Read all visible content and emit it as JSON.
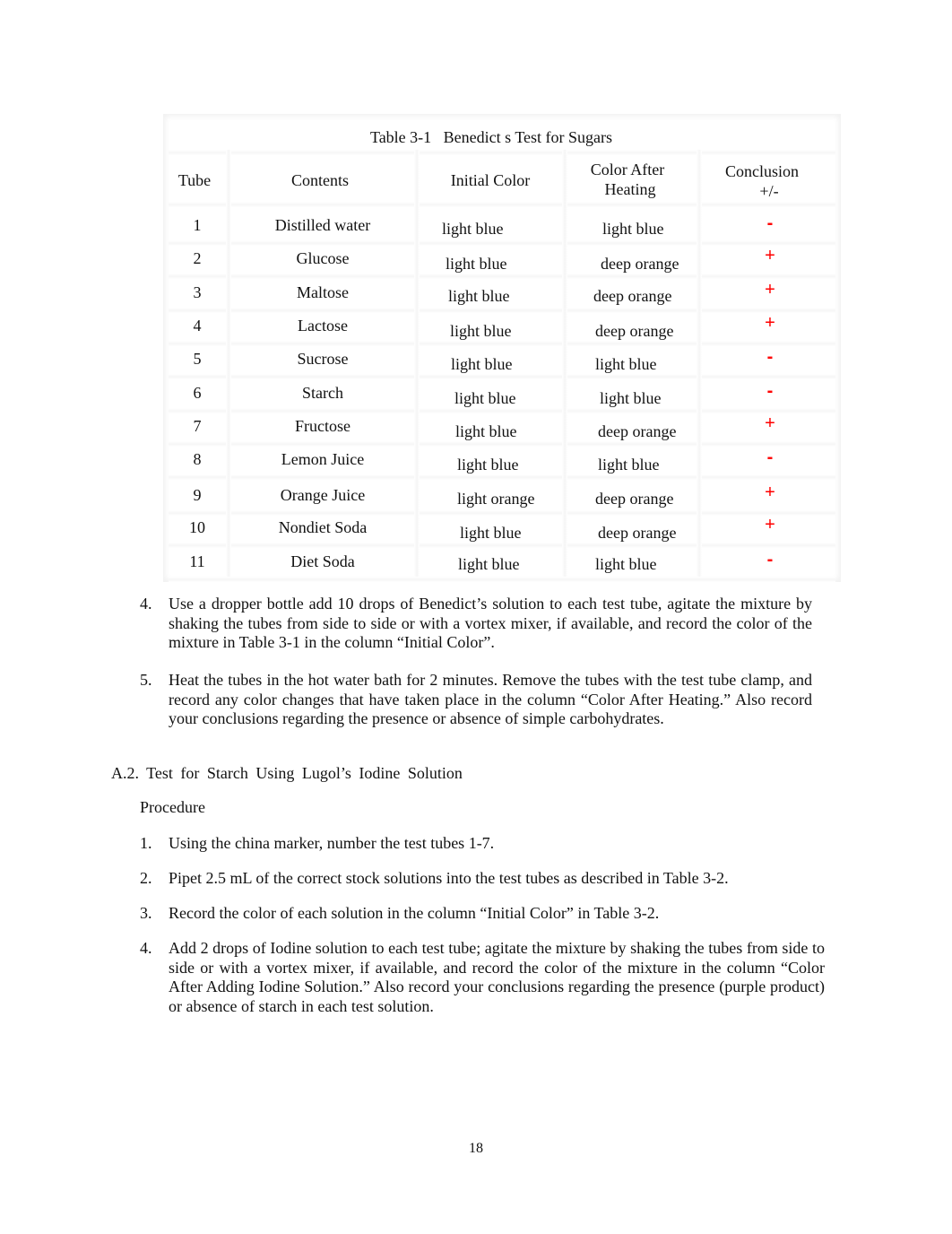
{
  "table": {
    "caption": "Table 3-1   Benedict s Test for Sugars",
    "headers": {
      "tube": "Tube",
      "contents": "Contents",
      "initial_color": "Initial Color",
      "color_after_line1": "Color After",
      "color_after_line2": "Heating",
      "conclusion_line1": "Conclusion",
      "conclusion_line2": "+/-"
    },
    "rows": [
      {
        "tube": "1",
        "contents": "Distilled water",
        "initial": "light blue",
        "after": "light blue",
        "conclusion": "-"
      },
      {
        "tube": "2",
        "contents": "Glucose",
        "initial": "light blue",
        "after": "deep orange",
        "conclusion": "+"
      },
      {
        "tube": "3",
        "contents": "Maltose",
        "initial": "light blue",
        "after": "deep orange",
        "conclusion": "+"
      },
      {
        "tube": "4",
        "contents": "Lactose",
        "initial": "light blue",
        "after": "deep orange",
        "conclusion": "+"
      },
      {
        "tube": "5",
        "contents": "Sucrose",
        "initial": "light blue",
        "after": "light blue",
        "conclusion": "-"
      },
      {
        "tube": "6",
        "contents": "Starch",
        "initial": "light blue",
        "after": "light blue",
        "conclusion": "-"
      },
      {
        "tube": "7",
        "contents": "Fructose",
        "initial": "light blue",
        "after": "deep orange",
        "conclusion": "+"
      },
      {
        "tube": "8",
        "contents": "Lemon Juice",
        "initial": "light blue",
        "after": "light blue",
        "conclusion": "-"
      },
      {
        "tube": "9",
        "contents": "Orange Juice",
        "initial": "light orange",
        "after": "deep orange",
        "conclusion": "+"
      },
      {
        "tube": "10",
        "contents": "Nondiet Soda",
        "initial": "light blue",
        "after": "deep orange",
        "conclusion": "+"
      },
      {
        "tube": "11",
        "contents": "Diet Soda",
        "initial": "light blue",
        "after": "light blue",
        "conclusion": "-"
      }
    ],
    "conclusion_color": "#ff0000"
  },
  "steps_a1": [
    {
      "num": "4.",
      "text": "Use a dropper bottle add 10 drops of Benedict’s solution to each test tube, agitate the mixture by shaking the tubes from side to side or with a vortex mixer, if available, and record the color of the mixture in Table 3-1 in the column “Initial Color”."
    },
    {
      "num": "5.",
      "text": "Heat the tubes in the hot water bath for 2 minutes. Remove the tubes with the test tube clamp, and record any color changes that have taken place in the column “Color After Heating.” Also record your conclusions regarding the presence or absence of simple carbohydrates."
    }
  ],
  "section_a2": {
    "heading": "A.2. Test for Starch Using Lugol’s Iodine Solution",
    "subheading": "Procedure",
    "steps": [
      {
        "num": "1.",
        "text": "Using the china marker, number the test tubes 1-7."
      },
      {
        "num": "2.",
        "text": "Pipet 2.5 mL of the correct stock solutions into the test tubes as described in Table 3-2."
      },
      {
        "num": "3.",
        "text": "Record the color of each solution in the column “Initial Color” in Table 3-2."
      },
      {
        "num": "4.",
        "text": "Add 2 drops of Iodine solution to each test tube; agitate the mixture by shaking the tubes from side to side or with a vortex mixer, if available, and record the color of the mixture in the column “Color After Adding Iodine Solution.” Also record your conclusions regarding the presence (purple product) or absence of starch in each test solution."
      }
    ]
  },
  "page_number": "18"
}
